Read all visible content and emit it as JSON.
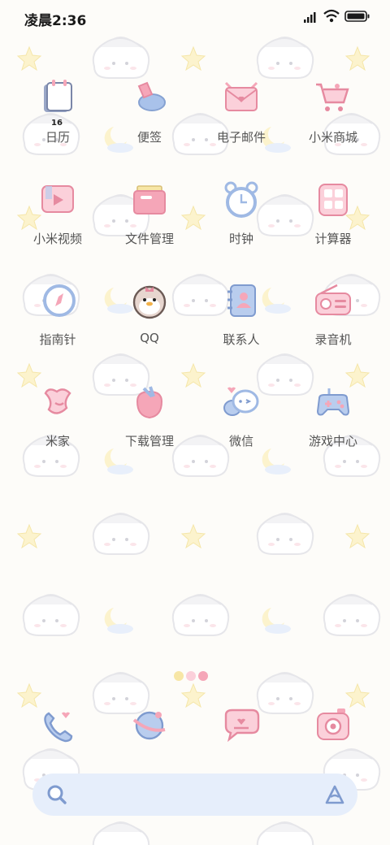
{
  "status_bar": {
    "time": "凌晨2:36"
  },
  "apps": [
    {
      "label": "日历",
      "icon": "calendar-icon",
      "date_badge": "16"
    },
    {
      "label": "便签",
      "icon": "notes-icon"
    },
    {
      "label": "电子邮件",
      "icon": "email-icon"
    },
    {
      "label": "小米商城",
      "icon": "shop-cart-icon"
    },
    {
      "label": "小米视频",
      "icon": "video-icon"
    },
    {
      "label": "文件管理",
      "icon": "file-manager-icon"
    },
    {
      "label": "时钟",
      "icon": "clock-icon"
    },
    {
      "label": "计算器",
      "icon": "calculator-icon"
    },
    {
      "label": "指南针",
      "icon": "compass-icon"
    },
    {
      "label": "QQ",
      "icon": "qq-penguin-icon"
    },
    {
      "label": "联系人",
      "icon": "contacts-icon"
    },
    {
      "label": "录音机",
      "icon": "recorder-icon"
    },
    {
      "label": "米家",
      "icon": "mijia-icon"
    },
    {
      "label": "下载管理",
      "icon": "download-icon"
    },
    {
      "label": "微信",
      "icon": "wechat-icon"
    },
    {
      "label": "游戏中心",
      "icon": "gamepad-icon"
    }
  ],
  "dock": [
    {
      "icon": "phone-icon"
    },
    {
      "icon": "browser-icon"
    },
    {
      "icon": "messages-icon"
    },
    {
      "icon": "camera-icon"
    }
  ],
  "colors": {
    "pink": "#f5a6b8",
    "blue": "#9fb9e4",
    "search_bg": "#e6eefb"
  }
}
